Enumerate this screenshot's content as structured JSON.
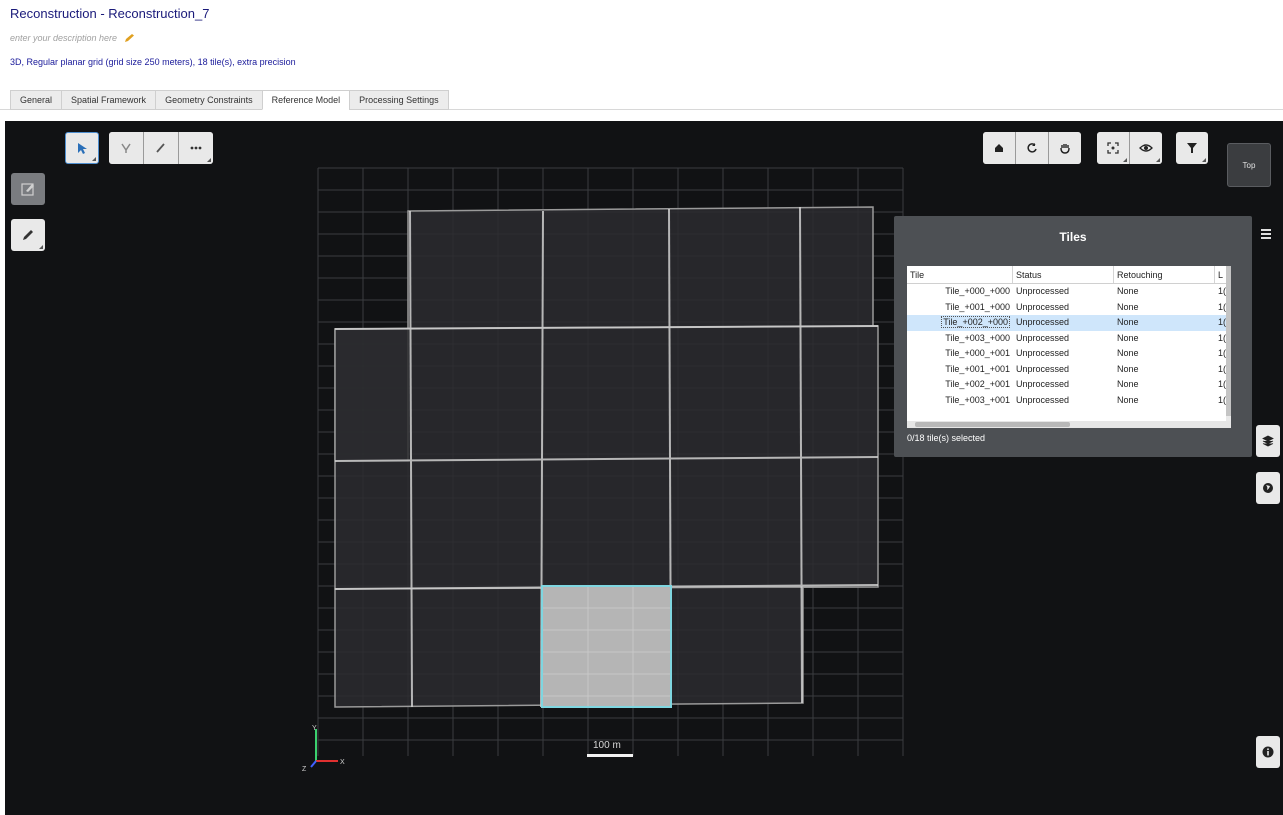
{
  "header": {
    "title": "Reconstruction - Reconstruction_7",
    "description_placeholder": "enter your description here",
    "summary": "3D, Regular planar grid (grid size 250 meters), 18 tile(s), extra precision"
  },
  "tabs": [
    {
      "label": "General"
    },
    {
      "label": "Spatial Framework"
    },
    {
      "label": "Geometry Constraints"
    },
    {
      "label": "Reference Model"
    },
    {
      "label": "Processing Settings"
    }
  ],
  "active_tab": "Reference Model",
  "viewport": {
    "view_button_label": "Top",
    "scale_label": "100 m",
    "axis_labels": {
      "x": "X",
      "y": "Y",
      "z": "Z"
    }
  },
  "tiles_panel": {
    "title": "Tiles",
    "columns": [
      "Tile",
      "Status",
      "Retouching",
      "L"
    ],
    "rows": [
      {
        "tile": "Tile_+000_+000",
        "status": "Unprocessed",
        "retouching": "None",
        "l": "1("
      },
      {
        "tile": "Tile_+001_+000",
        "status": "Unprocessed",
        "retouching": "None",
        "l": "1("
      },
      {
        "tile": "Tile_+002_+000",
        "status": "Unprocessed",
        "retouching": "None",
        "l": "1("
      },
      {
        "tile": "Tile_+003_+000",
        "status": "Unprocessed",
        "retouching": "None",
        "l": "1("
      },
      {
        "tile": "Tile_+000_+001",
        "status": "Unprocessed",
        "retouching": "None",
        "l": "1("
      },
      {
        "tile": "Tile_+001_+001",
        "status": "Unprocessed",
        "retouching": "None",
        "l": "1("
      },
      {
        "tile": "Tile_+002_+001",
        "status": "Unprocessed",
        "retouching": "None",
        "l": "1("
      },
      {
        "tile": "Tile_+003_+001",
        "status": "Unprocessed",
        "retouching": "None",
        "l": "1("
      }
    ],
    "selected_row": "Tile_+002_+000",
    "status_text": "0/18 tile(s) selected"
  },
  "colors": {
    "viewport_bg": "#111214",
    "selection_outline": "#7fd6e0",
    "selected_fill": "#b5b5b5",
    "panel_bg": "#4d5054",
    "title_text": "#1a1a7a"
  },
  "icons": [
    "select-arrow-icon",
    "selection-mode-icon",
    "draw-icon",
    "more-icon",
    "edit-icon",
    "pencil-icon",
    "home-icon",
    "rotate-icon",
    "pan-hand-icon",
    "fit-view-icon",
    "visibility-eye-icon",
    "filter-icon",
    "list-icon",
    "layers-icon",
    "globe-icon",
    "info-icon",
    "axis-gizmo-icon"
  ]
}
